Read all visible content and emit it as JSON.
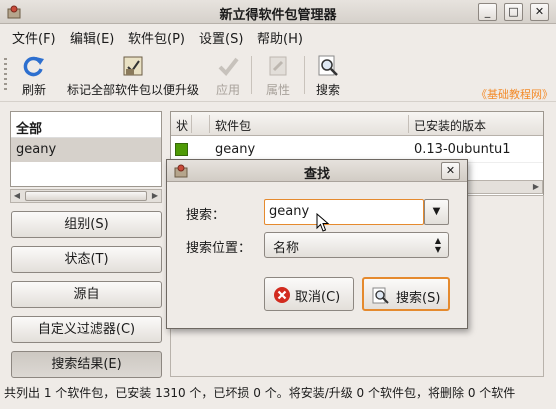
{
  "window": {
    "title": "新立得软件包管理器"
  },
  "menu": [
    "文件(F)",
    "编辑(E)",
    "软件包(P)",
    "设置(S)",
    "帮助(H)"
  ],
  "toolbar": {
    "refresh": "刷新",
    "mark_all_upgrades": "标记全部软件包以便升级",
    "apply": "应用",
    "properties": "属性",
    "search": "搜索"
  },
  "watermark": "《基础教程网》",
  "filters": {
    "all": "全部",
    "selected": "geany"
  },
  "side_buttons": {
    "sections": "组别(S)",
    "status": "状态(T)",
    "origin": "源自",
    "custom_filters": "自定义过滤器(C)",
    "search_results": "搜索结果(E)"
  },
  "table": {
    "columns": {
      "status": "状",
      "package": "软件包",
      "installed_version": "已安装的版本"
    },
    "rows": [
      {
        "package": "geany",
        "installed_version": "0.13-0ubuntu1",
        "status_color": "#4e9a06"
      }
    ]
  },
  "statusbar": "共列出 1 个软件包，已安装 1310 个，已坏损 0 个。将安装/升级 0 个软件包，将删除 0 个软件",
  "dialog": {
    "title": "查找",
    "search_label": "搜索：",
    "search_value": "geany",
    "search_in_label": "搜索位置：",
    "search_in_value": "名称",
    "cancel": "取消(C)",
    "search_button": "搜索(S)"
  },
  "colors": {
    "accent": "#e58a2e",
    "watermark": "#f38b2a"
  }
}
